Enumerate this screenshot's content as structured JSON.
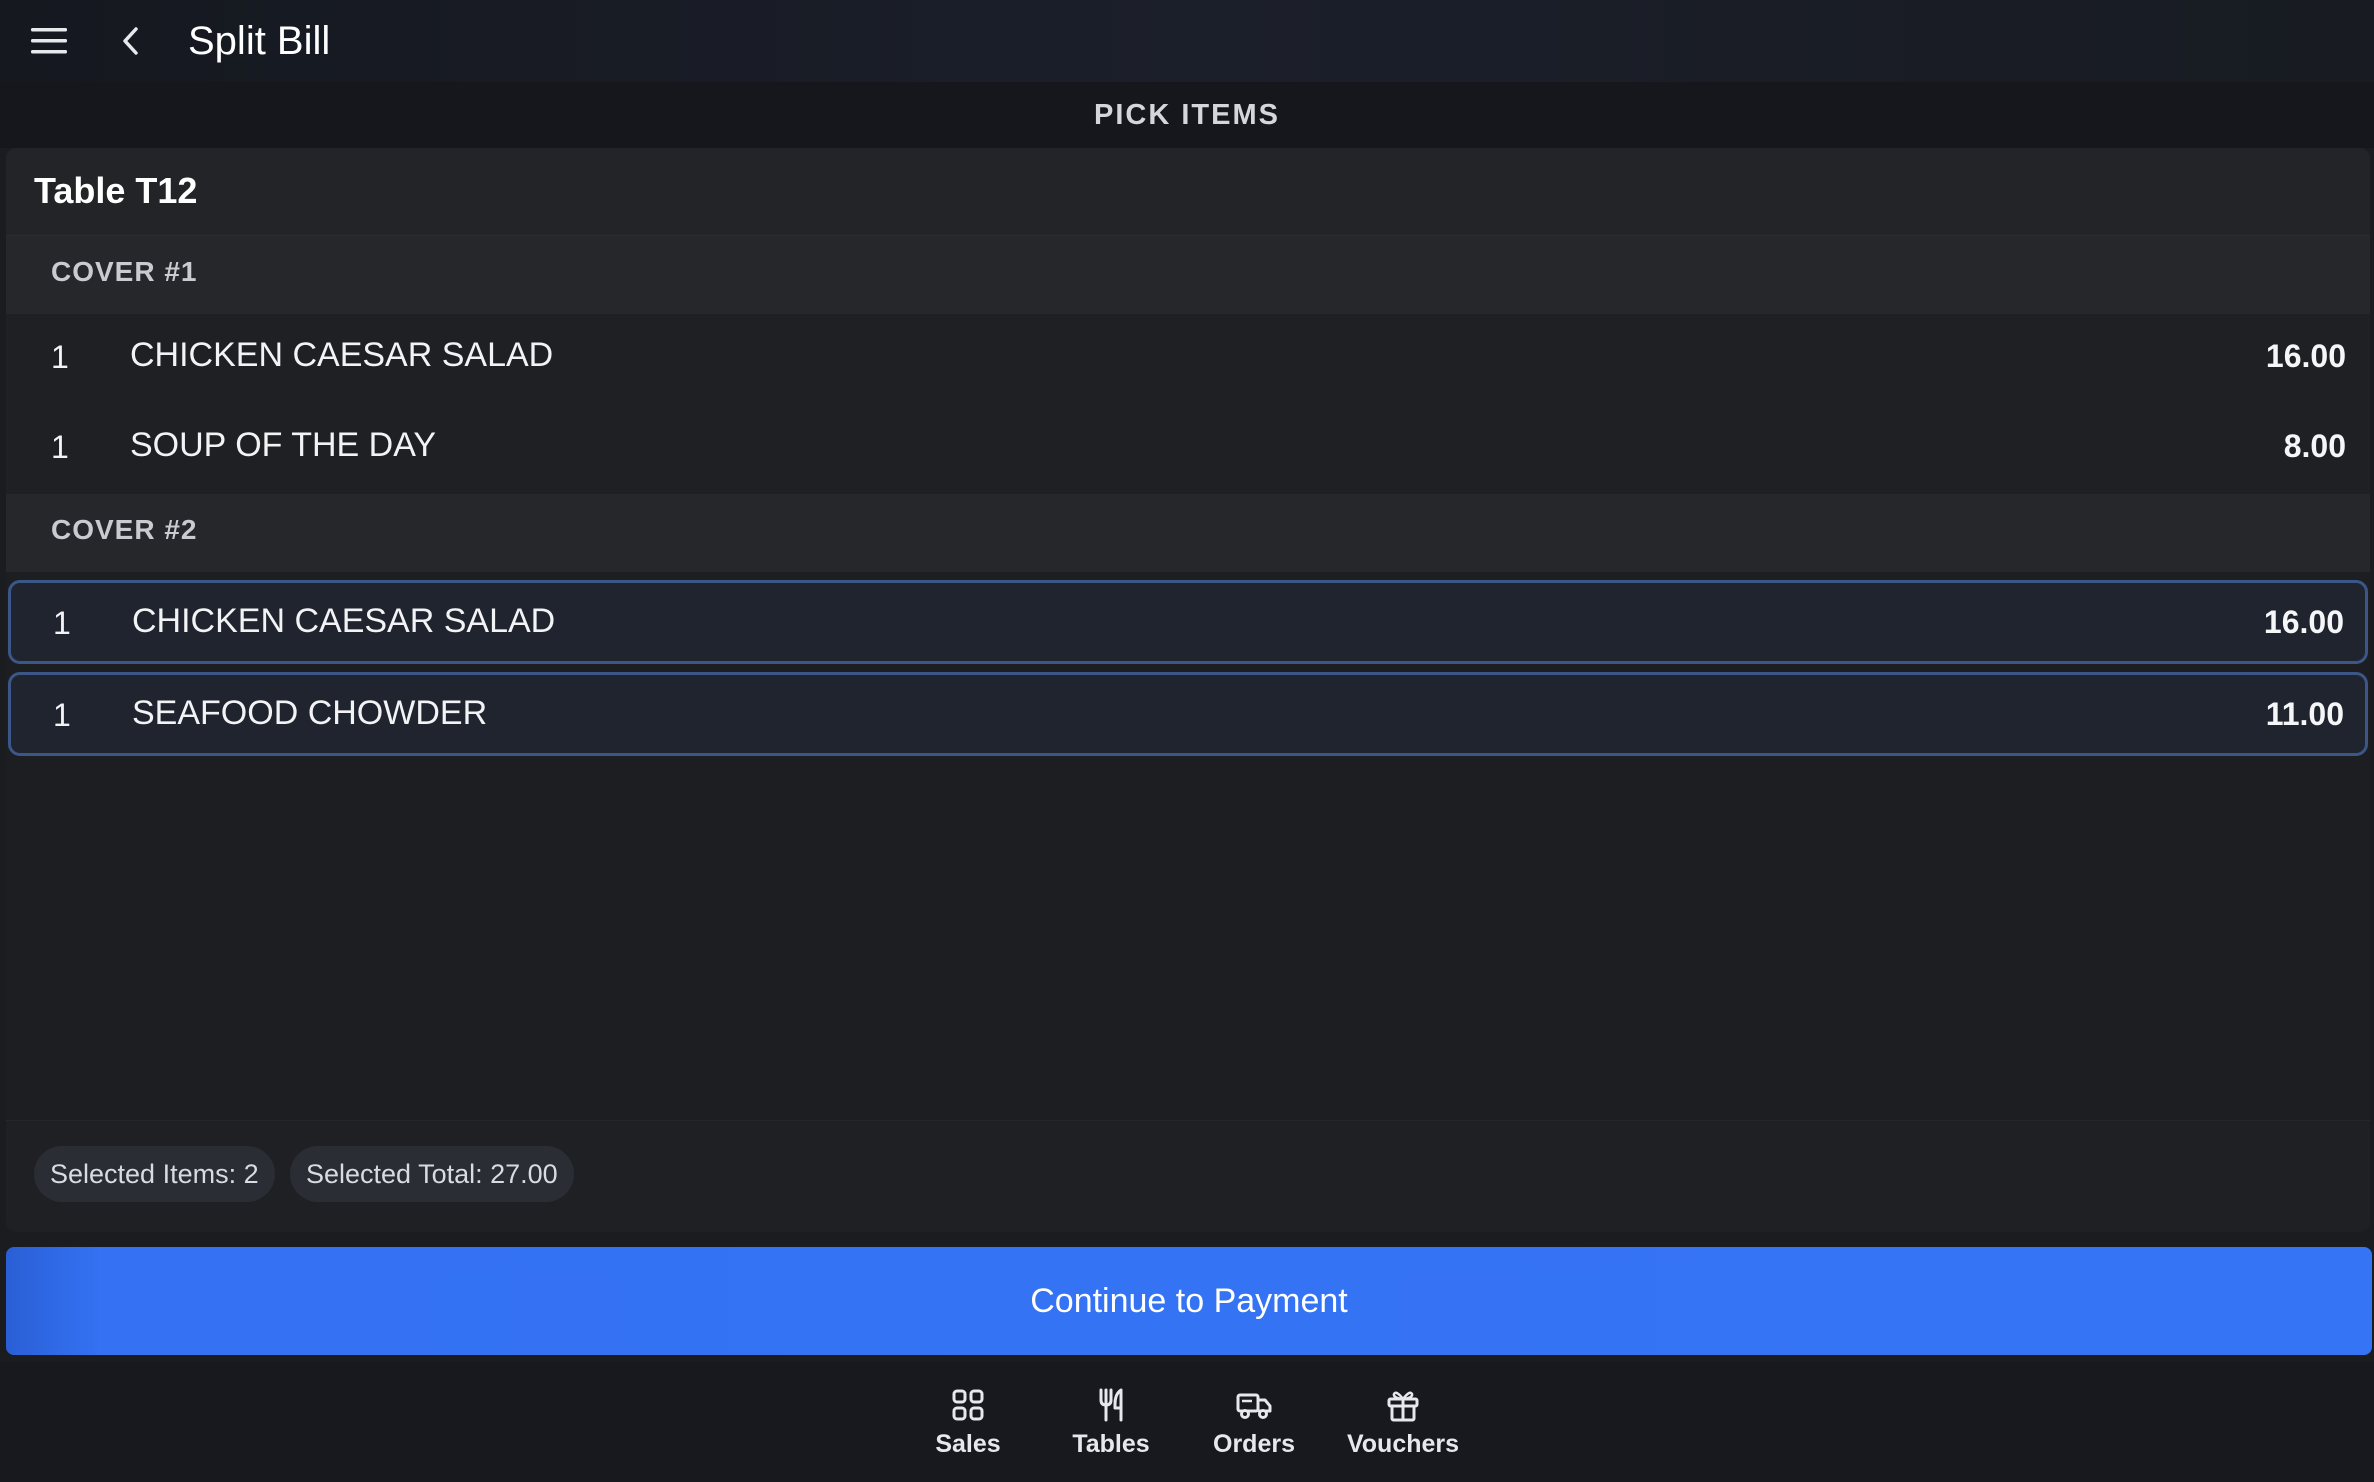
{
  "appbar": {
    "title": "Split Bill",
    "menu_icon": "hamburger-menu-icon",
    "back_icon": "chevron-left-icon"
  },
  "section": {
    "title": "PICK ITEMS"
  },
  "table": {
    "name": "Table T12"
  },
  "covers": [
    {
      "label": "COVER #1",
      "items": [
        {
          "qty": "1",
          "name": "CHICKEN CAESAR SALAD",
          "price": "16.00",
          "selected": false
        },
        {
          "qty": "1",
          "name": "SOUP OF THE DAY",
          "price": "8.00",
          "selected": false
        }
      ]
    },
    {
      "label": "COVER #2",
      "items": [
        {
          "qty": "1",
          "name": "CHICKEN CAESAR SALAD",
          "price": "16.00",
          "selected": true
        },
        {
          "qty": "1",
          "name": "SEAFOOD CHOWDER",
          "price": "11.00",
          "selected": true
        }
      ]
    }
  ],
  "summary": {
    "selected_items": "Selected Items: 2",
    "selected_total": "Selected Total: 27.00"
  },
  "actions": {
    "continue_label": "Continue to Payment"
  },
  "bottom_nav": {
    "items": [
      {
        "label": "Sales",
        "icon": "grid-icon"
      },
      {
        "label": "Tables",
        "icon": "fork-knife-icon"
      },
      {
        "label": "Orders",
        "icon": "delivery-truck-icon"
      },
      {
        "label": "Vouchers",
        "icon": "gift-icon"
      }
    ]
  },
  "colors": {
    "accent": "#3574f5",
    "selected_border": "#3b5788",
    "background": "#1b1c20"
  }
}
